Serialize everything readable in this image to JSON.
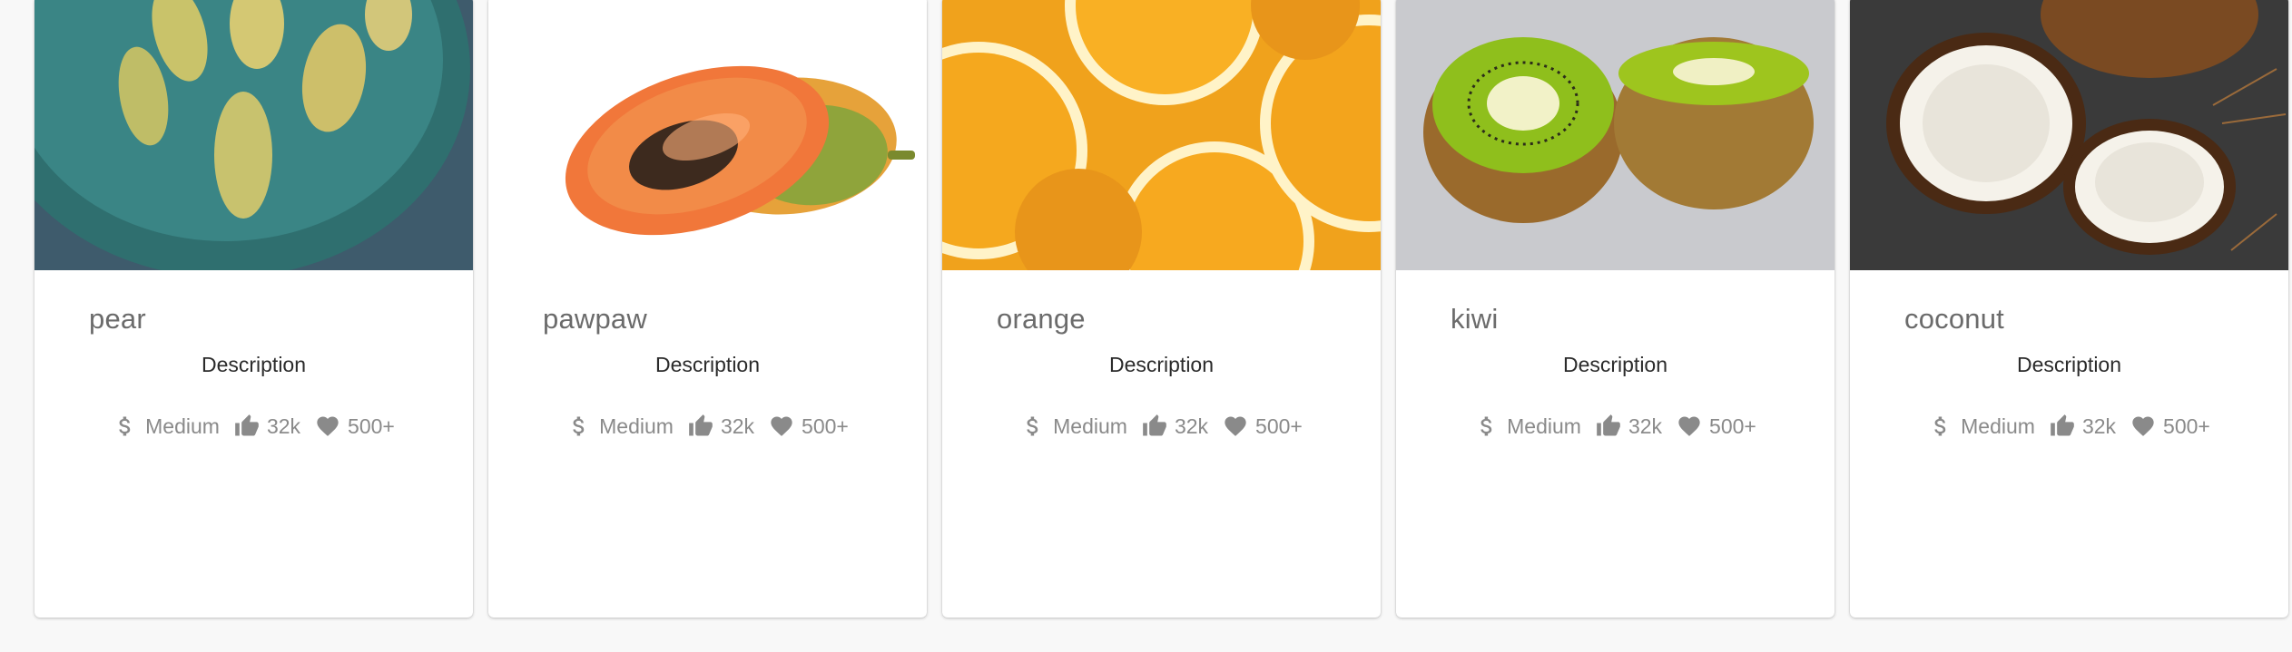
{
  "cards": [
    {
      "title": "pear",
      "description": "Description",
      "price": "Medium",
      "likes": "32k",
      "favorites": "500+",
      "image": "pear-photo"
    },
    {
      "title": "pawpaw",
      "description": "Description",
      "price": "Medium",
      "likes": "32k",
      "favorites": "500+",
      "image": "pawpaw-photo"
    },
    {
      "title": "orange",
      "description": "Description",
      "price": "Medium",
      "likes": "32k",
      "favorites": "500+",
      "image": "orange-photo"
    },
    {
      "title": "kiwi",
      "description": "Description",
      "price": "Medium",
      "likes": "32k",
      "favorites": "500+",
      "image": "kiwi-photo"
    },
    {
      "title": "coconut",
      "description": "Description",
      "price": "Medium",
      "likes": "32k",
      "favorites": "500+",
      "image": "coconut-photo"
    }
  ],
  "icons": {
    "price": "dollar-icon",
    "likes": "thumb-up-icon",
    "favorites": "heart-icon"
  },
  "colors": {
    "background": "#f8f8f8",
    "card": "#ffffff",
    "title": "#6b6b6b",
    "meta": "#8a8a8a"
  }
}
